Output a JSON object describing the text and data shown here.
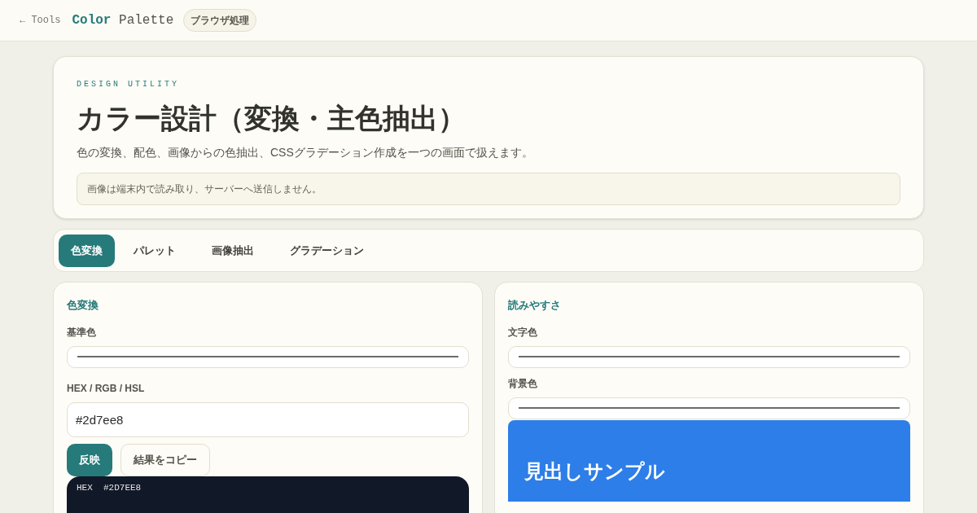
{
  "header": {
    "back_link": "← Tools",
    "title_bold": "Color",
    "title_rest": "Palette",
    "badge": "ブラウザ処理"
  },
  "hero": {
    "eyebrow": "DESIGN UTILITY",
    "title": "カラー設計（変換・主色抽出）",
    "description": "色の変換、配色、画像からの色抽出、CSSグラデーション作成を一つの画面で扱えます。",
    "notice": "画像は端末内で読み取り、サーバーへ送信しません。"
  },
  "tabs": [
    {
      "label": "色変換",
      "selected": true
    },
    {
      "label": "パレット",
      "selected": false
    },
    {
      "label": "画像抽出",
      "selected": false
    },
    {
      "label": "グラデーション",
      "selected": false
    }
  ],
  "converter": {
    "heading": "色変換",
    "fields": [
      {
        "kind": "color",
        "label": "基準色"
      },
      {
        "kind": "text",
        "label": "HEX / RGB / HSL",
        "value": "#2d7ee8"
      }
    ],
    "buttons": [
      {
        "label": "反映",
        "primary": true
      },
      {
        "label": "結果をコピー",
        "primary": false
      }
    ],
    "output": "HEX  #2D7EE8"
  },
  "readability": {
    "heading": "読みやすさ",
    "fields": [
      {
        "kind": "color",
        "label": "文字色"
      },
      {
        "kind": "color",
        "label": "背景色"
      }
    ],
    "preview": {
      "color": "#2d7ee8",
      "heading": "見出しサンプル"
    }
  }
}
